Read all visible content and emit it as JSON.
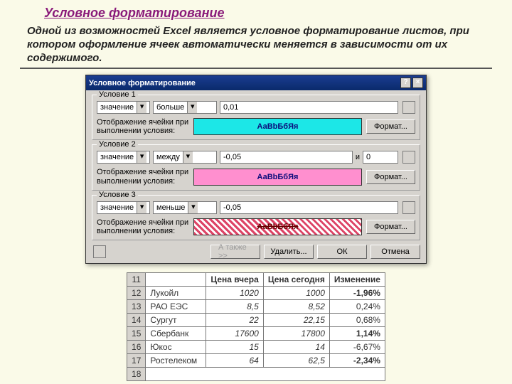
{
  "page": {
    "heading": "Условное форматирование",
    "desc": "Одной из возможностей Excel является условное форматирование листов, при котором оформление ячеек автоматически меняется в зависимости от их содержимого."
  },
  "dialog": {
    "title": "Условное форматирование",
    "preview_sample": "АаВbБбЯя",
    "desc_label": "Отображение ячейки при выполнении условия:",
    "format_btn": "Формат...",
    "and_label": "и",
    "conds": [
      {
        "legend": "Условие 1",
        "what": "значение",
        "op": "больше",
        "v1": "0,01",
        "v2": null
      },
      {
        "legend": "Условие 2",
        "what": "значение",
        "op": "между",
        "v1": "-0,05",
        "v2": "0"
      },
      {
        "legend": "Условие 3",
        "what": "значение",
        "op": "меньше",
        "v1": "-0,05",
        "v2": null
      }
    ],
    "footer": {
      "also": "А также >>",
      "delete": "Удалить...",
      "ok": "ОК",
      "cancel": "Отмена"
    }
  },
  "sheet": {
    "headers": [
      "",
      "Цена вчера",
      "Цена сегодня",
      "Изменение"
    ],
    "rownums": [
      "11",
      "12",
      "13",
      "14",
      "15",
      "16",
      "17",
      "18"
    ],
    "rows": [
      {
        "name": "Лукойл",
        "y": "1020",
        "t": "1000",
        "d": "-1,96%",
        "cls": "neg-hil"
      },
      {
        "name": "РАО ЕЭС",
        "y": "8,5",
        "t": "8,52",
        "d": "0,24%",
        "cls": ""
      },
      {
        "name": "Сургут",
        "y": "22",
        "t": "22,15",
        "d": "0,68%",
        "cls": ""
      },
      {
        "name": "Сбербанк",
        "y": "17600",
        "t": "17800",
        "d": "1,14%",
        "cls": "pos-hil"
      },
      {
        "name": "Юкос",
        "y": "15",
        "t": "14",
        "d": "-6,67%",
        "cls": "strike-hil"
      },
      {
        "name": "Ростелеком",
        "y": "64",
        "t": "62,5",
        "d": "-2,34%",
        "cls": "neg-hil"
      }
    ]
  }
}
